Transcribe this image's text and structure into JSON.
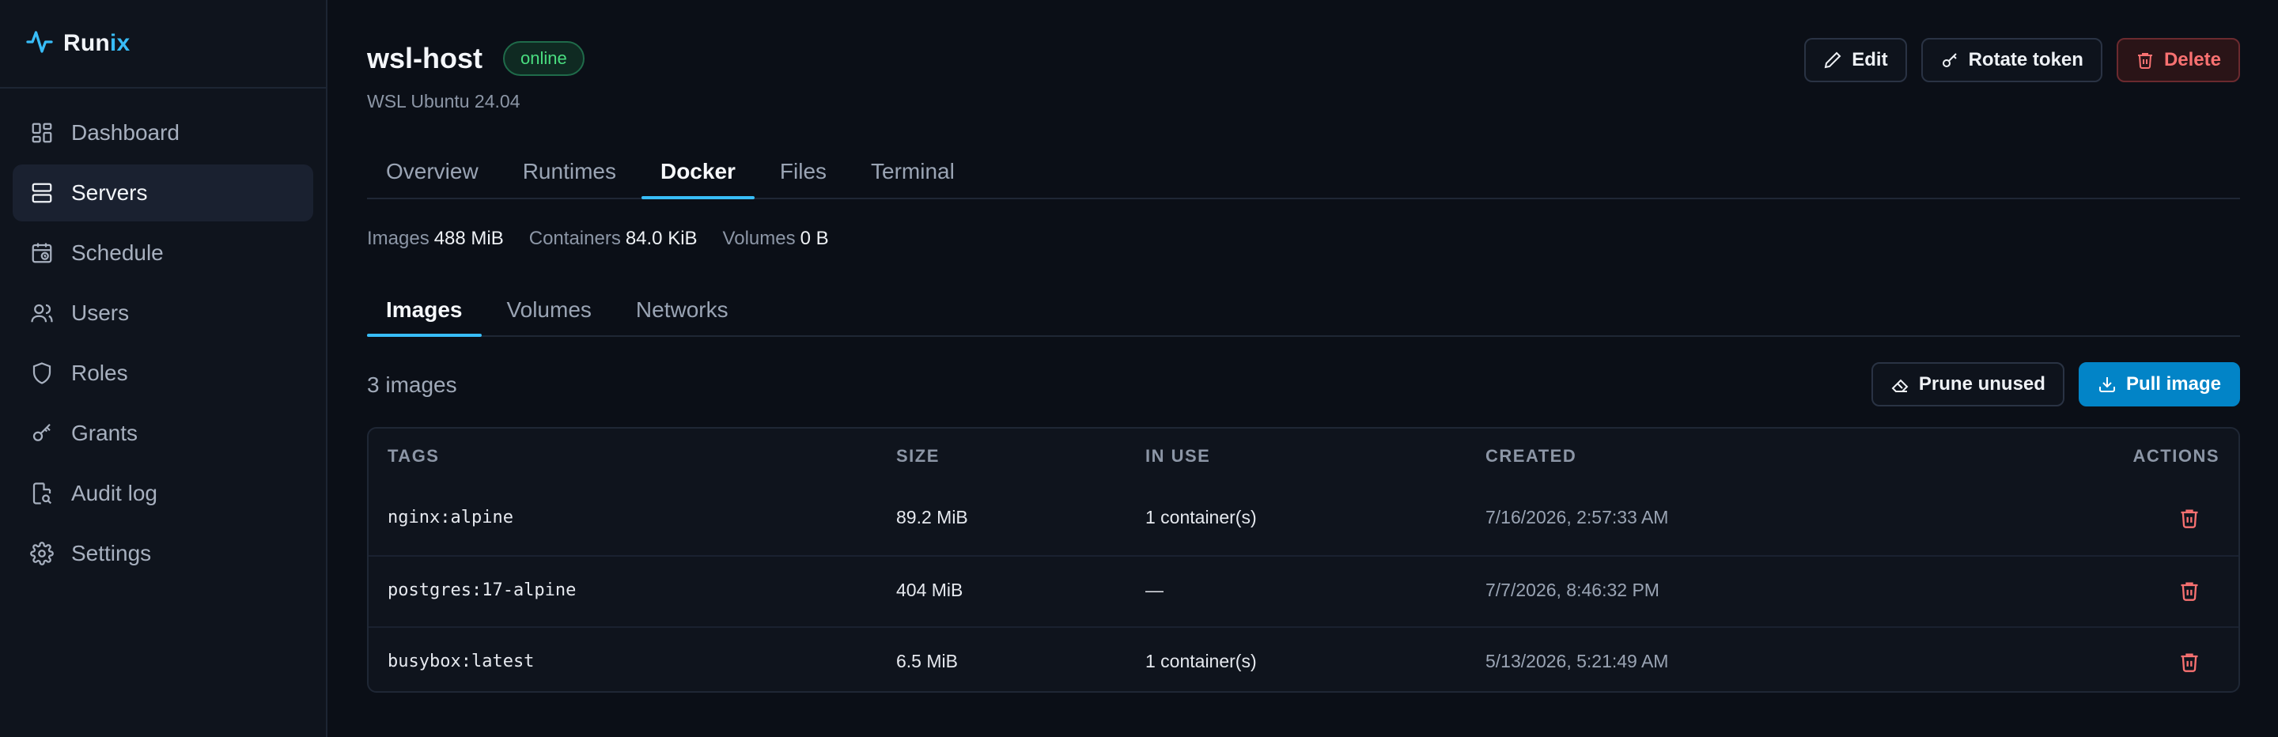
{
  "app": {
    "brand_part1": "Run",
    "brand_part2": "ix"
  },
  "sidebar": {
    "items": [
      {
        "label": "Dashboard",
        "icon": "dashboard-icon"
      },
      {
        "label": "Servers",
        "icon": "servers-icon",
        "active": true
      },
      {
        "label": "Schedule",
        "icon": "calendar-clock-icon"
      },
      {
        "label": "Users",
        "icon": "users-icon"
      },
      {
        "label": "Roles",
        "icon": "shield-icon"
      },
      {
        "label": "Grants",
        "icon": "key-icon"
      },
      {
        "label": "Audit log",
        "icon": "file-search-icon"
      },
      {
        "label": "Settings",
        "icon": "gear-icon"
      }
    ]
  },
  "header": {
    "title": "wsl-host",
    "status": "online",
    "subtitle": "WSL Ubuntu 24.04",
    "edit_label": "Edit",
    "rotate_label": "Rotate token",
    "delete_label": "Delete"
  },
  "tabs": [
    "Overview",
    "Runtimes",
    "Docker",
    "Files",
    "Terminal"
  ],
  "active_tab": "Docker",
  "stats": {
    "images_label": "Images",
    "images_value": "488 MiB",
    "containers_label": "Containers",
    "containers_value": "84.0 KiB",
    "volumes_label": "Volumes",
    "volumes_value": "0 B"
  },
  "subtabs": [
    "Images",
    "Volumes",
    "Networks"
  ],
  "active_subtab": "Images",
  "images": {
    "count_text": "3 images",
    "prune_label": "Prune unused",
    "pull_label": "Pull image",
    "columns": [
      "TAGS",
      "SIZE",
      "IN USE",
      "CREATED",
      "ACTIONS"
    ],
    "rows": [
      {
        "tag": "nginx:alpine",
        "size": "89.2 MiB",
        "in_use": "1 container(s)",
        "created": "7/16/2026, 2:57:33 AM"
      },
      {
        "tag": "postgres:17-alpine",
        "size": "404 MiB",
        "in_use": "—",
        "created": "7/7/2026, 8:46:32 PM"
      },
      {
        "tag": "busybox:latest",
        "size": "6.5 MiB",
        "in_use": "1 container(s)",
        "created": "5/13/2026, 5:21:49 AM"
      }
    ]
  },
  "colors": {
    "accent": "#38bdf8",
    "primary_button": "#0284c7",
    "danger": "#f87171",
    "online": "#4ade80",
    "background": "#0b0f17"
  }
}
